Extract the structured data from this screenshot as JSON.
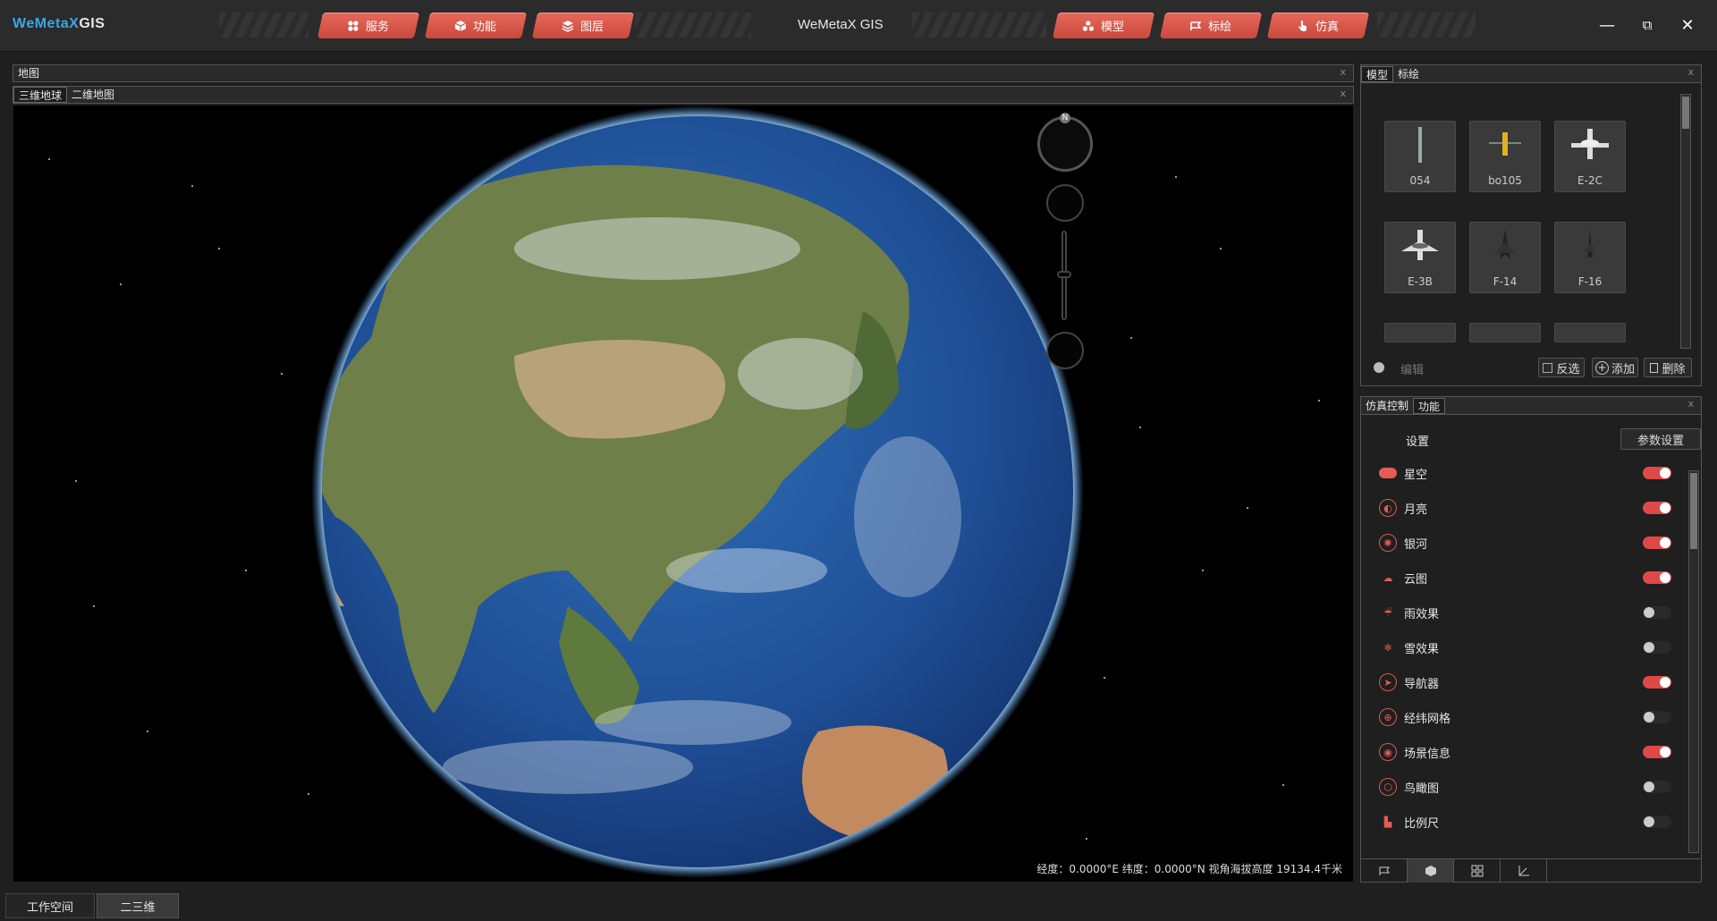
{
  "app": {
    "logo_main": "WeMetaX",
    "logo_suffix": "GIS",
    "title": "WeMetaX GIS",
    "accent_color": "#e55a4e"
  },
  "nav_left": [
    {
      "label": "服务",
      "icon": "service-icon"
    },
    {
      "label": "功能",
      "icon": "function-icon"
    },
    {
      "label": "图层",
      "icon": "layers-icon"
    }
  ],
  "nav_right": [
    {
      "label": "模型",
      "icon": "model-icon"
    },
    {
      "label": "标绘",
      "icon": "plot-icon"
    },
    {
      "label": "仿真",
      "icon": "simulation-icon"
    }
  ],
  "window_controls": {
    "minimize": "—",
    "restore": "⧉",
    "close": "✕"
  },
  "map_panel": {
    "tab": "地图",
    "close": "x",
    "subtabs": [
      "三维地球",
      "二维地图"
    ],
    "sub_close": "x",
    "compass_label": "N",
    "status": "经度：0.0000°E  纬度：0.0000°N  视角海拔高度 19134.4千米"
  },
  "model_panel": {
    "tabs": [
      "模型",
      "标绘"
    ],
    "close": "x",
    "models": [
      {
        "name": "054"
      },
      {
        "name": "bo105"
      },
      {
        "name": "E-2C"
      },
      {
        "name": "E-3B"
      },
      {
        "name": "F-14"
      },
      {
        "name": "F-16"
      }
    ],
    "edit_label": "编辑",
    "invert_label": "反选",
    "add_label": "添加",
    "delete_label": "删除"
  },
  "sim_panel": {
    "tabs": [
      "仿真控制",
      "功能"
    ],
    "close": "x",
    "settings_label": "设置",
    "param_button": "参数设置",
    "features": [
      {
        "label": "星空",
        "on": true,
        "icon": "star-sky-icon"
      },
      {
        "label": "月亮",
        "on": true,
        "icon": "moon-icon"
      },
      {
        "label": "银河",
        "on": true,
        "icon": "galaxy-icon"
      },
      {
        "label": "云图",
        "on": true,
        "icon": "cloud-icon"
      },
      {
        "label": "雨效果",
        "on": false,
        "icon": "rain-icon"
      },
      {
        "label": "雪效果",
        "on": false,
        "icon": "snow-icon"
      },
      {
        "label": "导航器",
        "on": true,
        "icon": "navigator-icon"
      },
      {
        "label": "经纬网格",
        "on": false,
        "icon": "grid-icon"
      },
      {
        "label": "场景信息",
        "on": true,
        "icon": "scene-info-icon"
      },
      {
        "label": "鸟瞰图",
        "on": false,
        "icon": "overview-icon"
      },
      {
        "label": "比例尺",
        "on": false,
        "icon": "scale-icon"
      }
    ]
  },
  "bottom_tabs": [
    "工作空间",
    "二三维"
  ]
}
